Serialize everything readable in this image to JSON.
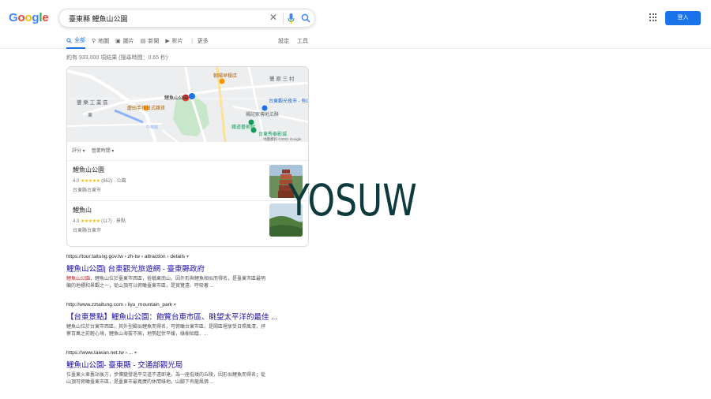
{
  "header": {
    "logo_letters": [
      {
        "ch": "G",
        "color": "#4285f4"
      },
      {
        "ch": "o",
        "color": "#ea4335"
      },
      {
        "ch": "o",
        "color": "#fbbc05"
      },
      {
        "ch": "g",
        "color": "#4285f4"
      },
      {
        "ch": "l",
        "color": "#34a853"
      },
      {
        "ch": "e",
        "color": "#ea4335"
      }
    ],
    "search_value": "臺東縣 鯉魚山公園",
    "signin_label": "登入"
  },
  "tabs": [
    {
      "label": "全部",
      "icon": "search-icon"
    },
    {
      "label": "地圖",
      "icon": "pin-icon"
    },
    {
      "label": "圖片",
      "icon": "image-icon"
    },
    {
      "label": "新聞",
      "icon": "news-icon"
    },
    {
      "label": "影片",
      "icon": "video-icon"
    },
    {
      "label": "更多",
      "icon": "more-icon"
    }
  ],
  "tools": {
    "settings": "設定",
    "tools": "工具"
  },
  "stats": "約有 933,000 項結果 (搜尋時間：0.65 秒)",
  "map": {
    "labels": {
      "district": "豐 樂 工 業 區",
      "market": "朝陽早餐店",
      "village": "豐 原 三 村",
      "craft": "慶田手作日式雜貨",
      "park_pin": "鯉魚山公園",
      "night": "台東觀光夜市 - 有GO小米沙·美味鐵板燒...",
      "gua": "楊記家傳地瓜酥",
      "art": "鐵道藝術村",
      "cinema": "台東秀泰影城",
      "east": "東",
      "road": "中華路",
      "copyright": "地圖資料 ©2021 Google"
    }
  },
  "filters": [
    "評分 ▾",
    "營業時間 ▾"
  ],
  "places": [
    {
      "name": "鯉魚山公園",
      "rating": "4.0",
      "stars": "★★★★★",
      "reviews": "(862)",
      "category": "公園",
      "address": "台東縣台東市"
    },
    {
      "name": "鯉魚山",
      "rating": "4.3",
      "stars": "★★★★★",
      "reviews": "(117)",
      "category": "景點",
      "address": "台東縣台東市"
    }
  ],
  "results": [
    {
      "url": "https://tour.taitung.gov.tw › zh-tw › attraction › details",
      "title": "鯉魚山公園| 台東觀光旅遊網 - 臺東縣政府",
      "snippet_line1_parts": [
        "鯉魚山公園",
        "．鯉魚山位於臺東市西區，俗稱東南山，因外形與鯉魚相似而得名，是臺東市區最明"
      ],
      "snippet_line2": "顯的地標和景觀之一，從山頂可以俯瞰臺東市區，是賞覽遠、呼吸著 ..."
    },
    {
      "url": "http://www.zztaitung.com › liyu_mountain_park",
      "title": "【台東景點】鯉魚山公園：飽覽台東市區、眺望太平洋的最佳 ...",
      "snippet_line1": "鯉魚山位於台東市西區，其外型酷似鯉魚而得名，可俯瞰台東市區，是鬧區裡享受日照風清，抒",
      "snippet_line2": "寮百萬之前輕心境，鯉魚山海拔不高，地勢起伏平緩，綠樹如蔭、..."
    },
    {
      "url": "https://www.taiwan.net.tw › ...",
      "title": "鯉魚山公園- 臺東縣 - 交通部觀光局",
      "snippet_line1": "位臺東火車舊站後方，步傳變發過平交道不遠即達，為一座低矮的丘陵，因形似鯉魚而得名；從",
      "snippet_line2": "山頂可俯瞰臺東市區，是臺東市最寬廣的休閒綠地，山腳下有龍鳳佛 ..."
    }
  ],
  "watermark": "YOSUW"
}
